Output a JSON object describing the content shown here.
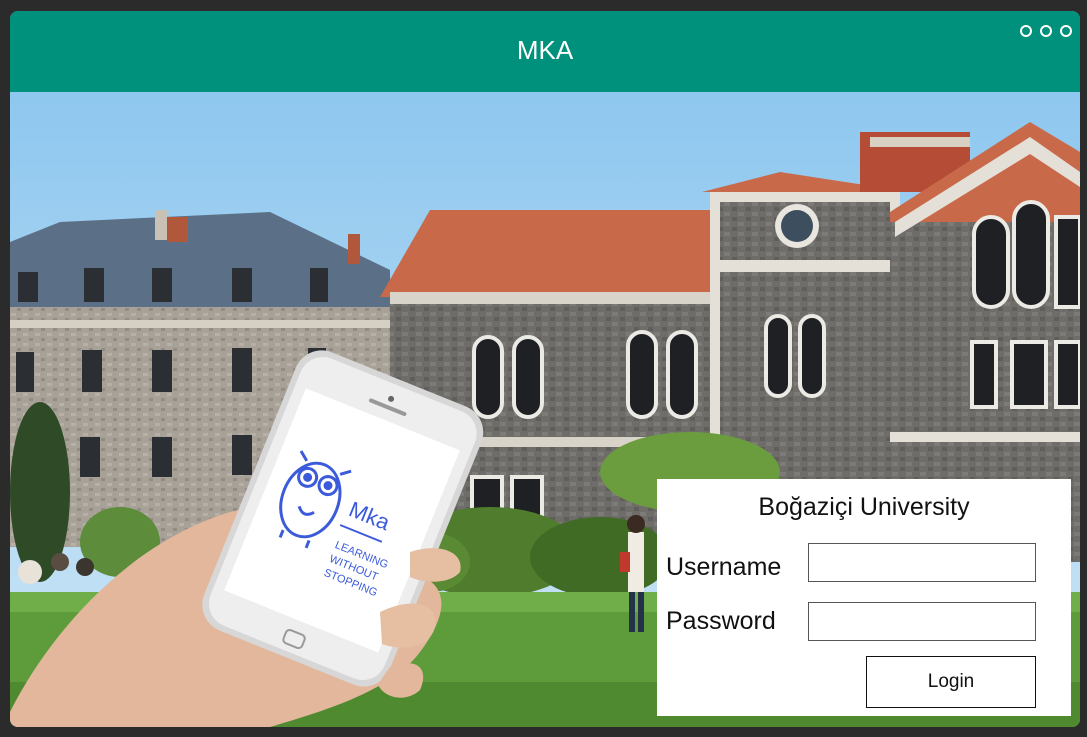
{
  "window": {
    "title": "MKA",
    "accent_color": "#00917c",
    "controls": [
      "circle-icon",
      "circle-icon",
      "circle-icon"
    ]
  },
  "hero": {
    "phone_logo_text": "Mka",
    "phone_tagline": [
      "LEARNING",
      "WITHOUT",
      "STOPPING"
    ]
  },
  "login": {
    "university": "Boğaziçi University",
    "username_label": "Username",
    "username_value": "",
    "password_label": "Password",
    "password_value": "",
    "login_button": "Login"
  }
}
